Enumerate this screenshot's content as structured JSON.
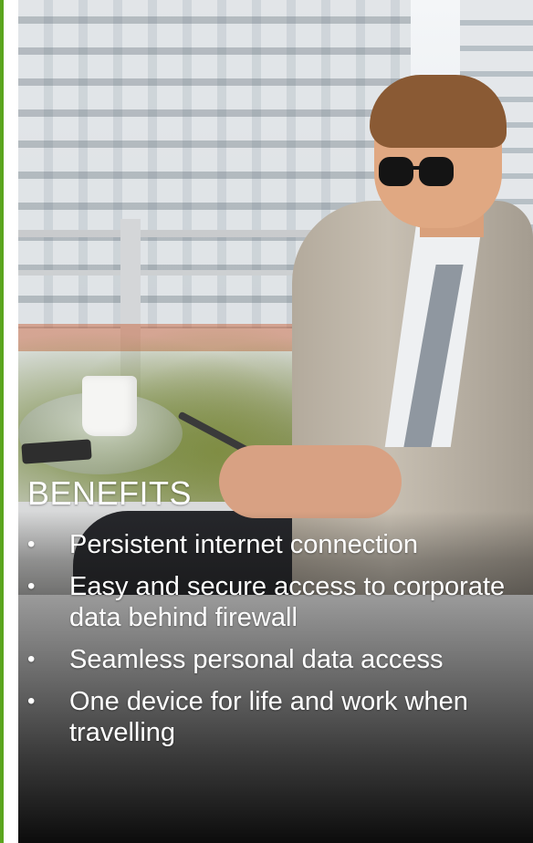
{
  "slide": {
    "heading": "BENEFITS",
    "bullets": [
      "Persistent internet connection",
      "Easy and secure access to corporate data behind firewall",
      "Seamless personal data access",
      "One device for life and work when travelling"
    ]
  },
  "colors": {
    "accent": "#5aa51e",
    "text": "#ffffff"
  }
}
